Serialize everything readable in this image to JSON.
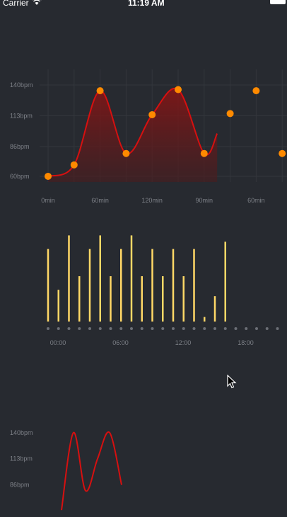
{
  "status_bar": {
    "carrier": "Carrier",
    "time": "11:19 AM",
    "wifi_icon": "wifi-icon",
    "battery_icon": "battery-icon"
  },
  "colors": {
    "background": "#272a30",
    "line_red": "#d61010",
    "point_orange": "#ff8a00",
    "bar_yellow": "#ffd866",
    "dot_gray": "#6b6e75",
    "grid": "#33363c",
    "tick": "#7d8087"
  },
  "chart_data": [
    {
      "type": "area",
      "y_labels": [
        "140bpm",
        "113bpm",
        "86bpm",
        "60bpm"
      ],
      "y_ticks": [
        140,
        113,
        86,
        60
      ],
      "x_labels": [
        "0min",
        "60min",
        "120min",
        "90min",
        "60min"
      ],
      "ylim": [
        55,
        145
      ],
      "points": [
        {
          "x": 0,
          "y": 60
        },
        {
          "x": 1,
          "y": 70
        },
        {
          "x": 2,
          "y": 135
        },
        {
          "x": 3,
          "y": 80
        },
        {
          "x": 4,
          "y": 114
        },
        {
          "x": 5,
          "y": 136
        },
        {
          "x": 6,
          "y": 80
        },
        {
          "x": 7,
          "y": 115
        },
        {
          "x": 8,
          "y": 135
        },
        {
          "x": 9,
          "y": 80
        }
      ],
      "line_through_index": 6.5,
      "grid": true
    },
    {
      "type": "bar",
      "x_labels": [
        "00:00",
        "06:00",
        "12:00",
        "18:00"
      ],
      "values": [
        0.8,
        0.35,
        0.95,
        0.5,
        0.8,
        0.95,
        0.5,
        0.8,
        0.95,
        0.5,
        0.8,
        0.5,
        0.8,
        0.5,
        0.8,
        0.05,
        0.28,
        0.88
      ],
      "slot_count": 23,
      "grid": false
    },
    {
      "type": "line",
      "y_labels": [
        "140bpm",
        "113bpm",
        "86bpm"
      ],
      "y_ticks": [
        140,
        113,
        86
      ],
      "ylim": [
        55,
        145
      ],
      "points": [
        {
          "x": 0,
          "y": 60
        },
        {
          "x": 1,
          "y": 140
        },
        {
          "x": 2,
          "y": 80
        },
        {
          "x": 3,
          "y": 113
        },
        {
          "x": 4,
          "y": 140
        },
        {
          "x": 5,
          "y": 86
        }
      ],
      "grid": false
    }
  ]
}
